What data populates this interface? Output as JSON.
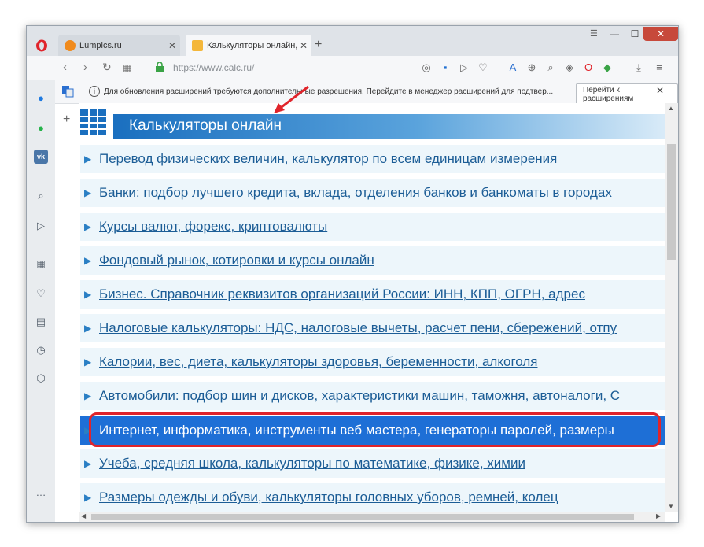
{
  "tabs": [
    {
      "title": "Lumpics.ru",
      "state": "inactive"
    },
    {
      "title": "Калькуляторы онлайн, спр",
      "state": "active"
    }
  ],
  "window_controls": {
    "menu": "☰",
    "minimize": "—",
    "maximize": "☐",
    "close": "✕"
  },
  "address": {
    "url": "https://www.calc.ru/"
  },
  "notification": {
    "message": "Для обновления расширений требуются дополнительные разрешения. Перейдите в менеджер расширений для подтвер...",
    "button": "Перейти к расширениям"
  },
  "page": {
    "header_title": "Калькуляторы онлайн",
    "categories": [
      "Перевод физических величин, калькулятор по всем единицам измерения",
      "Банки: подбор лучшего кредита, вклада, отделения банков и банкоматы в городах",
      "Курсы валют, форекс, криптовалюты",
      "Фондовый рынок, котировки и курсы онлайн",
      "Бизнес. Справочник реквизитов организаций России: ИНН, КПП, ОГРН, адрес",
      "Налоговые калькуляторы: НДС, налоговые вычеты, расчет пени, сбережений, отпу",
      "Калории, вес, диета, калькуляторы здоровья, беременности, алкоголя",
      "Автомобили: подбор шин и дисков, характеристики машин, таможня, автоналоги, С",
      "Интернет, информатика, инструменты веб мастера, генераторы паролей, размеры",
      "Учеба, средняя школа, калькуляторы по математике, физике, химии",
      "Размеры одежды и обуви, калькуляторы головных уборов, ремней, колец"
    ],
    "selected_index": 8
  },
  "colors": {
    "accent": "#1e6fd6",
    "highlight": "#e0242b",
    "link": "#1c5d96"
  }
}
